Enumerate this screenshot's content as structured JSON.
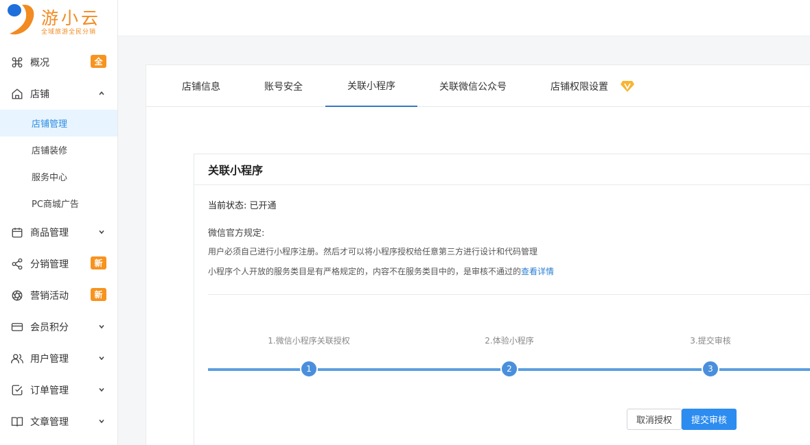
{
  "brand": {
    "name": "游小云",
    "slogan": "全域旅游全民分销",
    "orange": "#f28b21",
    "blue": "#1e6fd9"
  },
  "sidebar": {
    "items": [
      {
        "label": "概况",
        "icon": "command-icon",
        "badge": "全"
      },
      {
        "label": "店铺",
        "icon": "home-icon",
        "expanded": true,
        "children": [
          "店铺管理",
          "店铺装修",
          "服务中心",
          "PC商城广告"
        ]
      },
      {
        "label": "商品管理",
        "icon": "calendar-icon"
      },
      {
        "label": "分销管理",
        "icon": "share-icon",
        "badge": "新"
      },
      {
        "label": "营销活动",
        "icon": "aperture-icon",
        "badge": "新"
      },
      {
        "label": "会员积分",
        "icon": "credit-card-icon"
      },
      {
        "label": "用户管理",
        "icon": "users-icon"
      },
      {
        "label": "订单管理",
        "icon": "check-square-icon"
      },
      {
        "label": "文章管理",
        "icon": "book-icon"
      }
    ],
    "active_child": "店铺管理"
  },
  "tabs": [
    {
      "label": "店铺信息"
    },
    {
      "label": "账号安全"
    },
    {
      "label": "关联小程序",
      "active": true
    },
    {
      "label": "关联微信公众号"
    },
    {
      "label": "店铺权限设置"
    }
  ],
  "panel": {
    "title": "关联小程序",
    "status_label": "当前状态:",
    "status_value": "已开通",
    "rules_title": "微信官方规定:",
    "rule1": "用户必须自己进行小程序注册。然后才可以将小程序授权给任意第三方进行设计和代码管理",
    "rule2": "小程序个人开放的服务类目是有严格规定的，内容不在服务类目中的，是审核不通过的",
    "rule2_link": "查看详情"
  },
  "steps": [
    {
      "label": "1.微信小程序关联授权",
      "num": "1"
    },
    {
      "label": "2.体验小程序",
      "num": "2"
    },
    {
      "label": "3.提交审核",
      "num": "3"
    }
  ],
  "buttons": {
    "cancel": "取消授权",
    "submit": "提交审核"
  },
  "colors": {
    "accent": "#2d8cf0",
    "badge": "#f7931e",
    "active_bg": "#e8f4ff"
  }
}
